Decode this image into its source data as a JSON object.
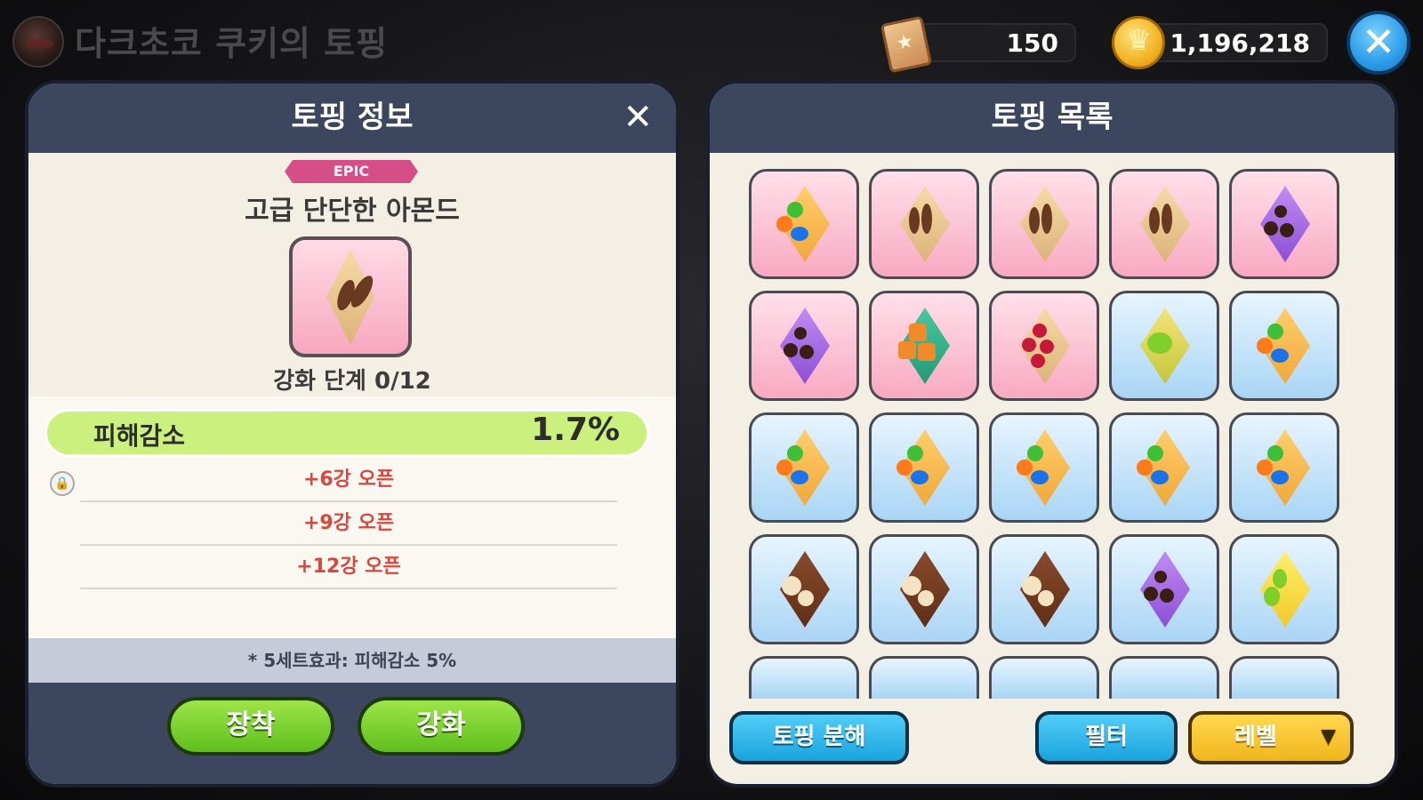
{
  "header": {
    "screen_title": "다크초코 쿠키의 토핑",
    "gems": "150",
    "coins": "1,196,218",
    "close_symbol": "✕"
  },
  "info_panel": {
    "title": "토핑 정보",
    "close_symbol": "✕",
    "rarity": "EPIC",
    "topping_name": "고급 단단한 아몬드",
    "enhance_stage": "강화 단계 0/12",
    "main_stat": {
      "label": "피해감소",
      "value": "1.7%"
    },
    "substats": [
      "+6강 오픈",
      "+9강 오픈",
      "+12강 오픈"
    ],
    "set_effect": "* 5세트효과: 피해감소 5%",
    "equip_button": "장착",
    "enhance_button": "강화"
  },
  "list_panel": {
    "title": "토핑 목록",
    "disassemble_button": "토핑 분해",
    "filter_button": "필터",
    "sort_button": "레벨",
    "items": [
      {
        "bg": "pink",
        "topping": "candy"
      },
      {
        "bg": "pink",
        "topping": "almond"
      },
      {
        "bg": "pink",
        "topping": "almond"
      },
      {
        "bg": "pink",
        "topping": "almond"
      },
      {
        "bg": "pink",
        "topping": "chocolate"
      },
      {
        "bg": "pink",
        "topping": "chocolate"
      },
      {
        "bg": "pink",
        "topping": "apple-jelly"
      },
      {
        "bg": "pink",
        "topping": "raspberry"
      },
      {
        "bg": "blue",
        "topping": "kiwi"
      },
      {
        "bg": "blue",
        "topping": "candy"
      },
      {
        "bg": "blue",
        "topping": "candy"
      },
      {
        "bg": "blue",
        "topping": "candy"
      },
      {
        "bg": "blue",
        "topping": "candy"
      },
      {
        "bg": "blue",
        "topping": "candy"
      },
      {
        "bg": "blue",
        "topping": "candy"
      },
      {
        "bg": "blue",
        "topping": "hazelnut"
      },
      {
        "bg": "blue",
        "topping": "hazelnut"
      },
      {
        "bg": "blue",
        "topping": "hazelnut"
      },
      {
        "bg": "blue",
        "topping": "chocolate"
      },
      {
        "bg": "blue",
        "topping": "green-bean"
      }
    ]
  },
  "colors": {
    "panel_header": "#3c465e",
    "rarity_epic": "#d54f86",
    "stat_bar": "#cbf07d",
    "locked_text": "#d9473f",
    "green_button": "#5fbf1c",
    "blue_button": "#19a4dd",
    "yellow_button": "#f0b51c"
  }
}
